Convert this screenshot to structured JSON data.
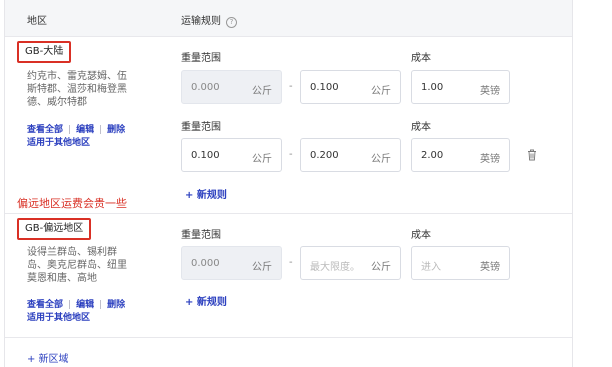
{
  "header": {
    "region_label": "地区",
    "rules_label": "运输规则",
    "help_icon": "?"
  },
  "regions": [
    {
      "name": "GB-大陆",
      "desc_lines": [
        "约克市、雷克瑟姆、伍",
        "斯特郡、温莎和梅登黑",
        "德、威尔特郡"
      ],
      "links": [
        "查看全部",
        "编辑",
        "删除"
      ],
      "apply": "适用于其他地区"
    },
    {
      "name": "GB-偏远地区",
      "desc_lines": [
        "设得兰群岛、锡利群",
        "岛、奥克尼群岛、纽里",
        "莫恩和唐、高地"
      ],
      "links": [
        "查看全部",
        "编辑",
        "删除"
      ],
      "apply": "适用于其他地区"
    }
  ],
  "annotation": "偏远地区运费会贵一些",
  "labels": {
    "weight_range": "重量范围",
    "cost": "成本",
    "dash": "-"
  },
  "rules": [
    {
      "min": "0.000",
      "min_unit": "公斤",
      "max": "0.100",
      "max_unit": "公斤",
      "cost": "1.00",
      "cost_unit": "英镑"
    },
    {
      "min": "0.100",
      "min_unit": "公斤",
      "max": "0.200",
      "max_unit": "公斤",
      "cost": "2.00",
      "cost_unit": "英镑"
    },
    {
      "min": "0.000",
      "min_unit": "公斤",
      "max_placeholder": "最大限度。",
      "max_unit": "公斤",
      "cost_placeholder": "进入",
      "cost_unit": "英镑"
    }
  ],
  "add_rule": "+ 新规则",
  "add_region": "+ 新区域",
  "colors": {
    "accent": "#2b3fbf",
    "highlight": "#d93025"
  }
}
